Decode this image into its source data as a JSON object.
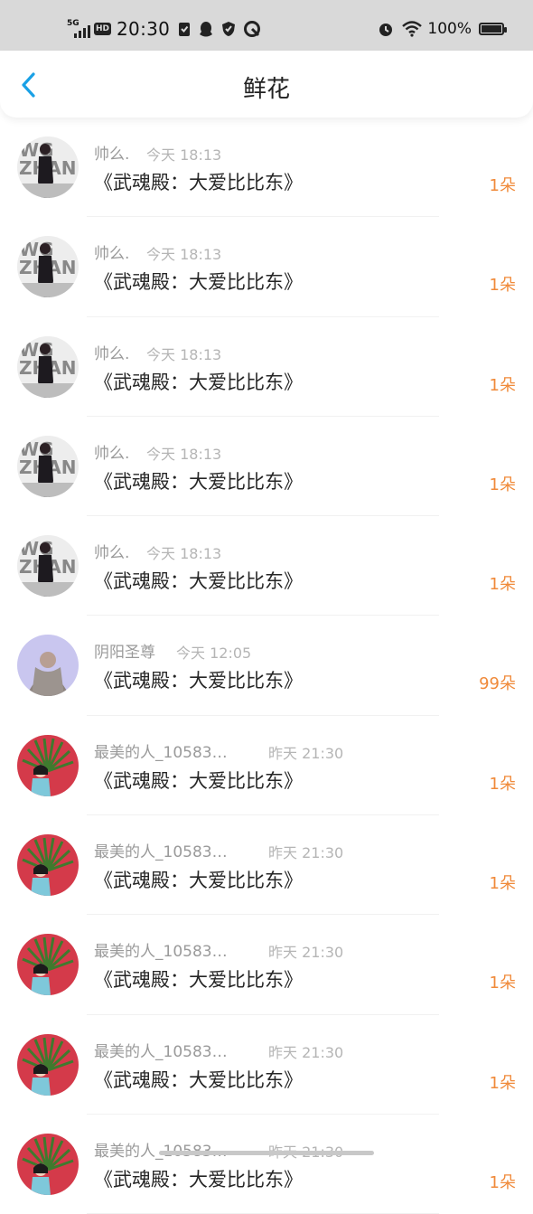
{
  "status_bar": {
    "network": "5G",
    "hd_label": "HD",
    "time": "20:30",
    "battery_text": "100%",
    "icons": [
      "signal-icon",
      "hd-icon",
      "clipboard-icon",
      "qq-icon",
      "shield-icon",
      "browser-icon",
      "alarm-icon",
      "wifi-icon",
      "battery-icon"
    ]
  },
  "header": {
    "title": "鲜花",
    "back_icon": "chevron-left-icon",
    "accent_color": "#1aa1e6"
  },
  "list": {
    "count_color": "#f08a3a",
    "items": [
      {
        "user": "帅么.",
        "time": "今天 18:13",
        "title": "《武魂殿：大爱比比东》",
        "count": "1朵",
        "avatar": "avatar-a"
      },
      {
        "user": "帅么.",
        "time": "今天 18:13",
        "title": "《武魂殿：大爱比比东》",
        "count": "1朵",
        "avatar": "avatar-a"
      },
      {
        "user": "帅么.",
        "time": "今天 18:13",
        "title": "《武魂殿：大爱比比东》",
        "count": "1朵",
        "avatar": "avatar-a"
      },
      {
        "user": "帅么.",
        "time": "今天 18:13",
        "title": "《武魂殿：大爱比比东》",
        "count": "1朵",
        "avatar": "avatar-a"
      },
      {
        "user": "帅么.",
        "time": "今天 18:13",
        "title": "《武魂殿：大爱比比东》",
        "count": "1朵",
        "avatar": "avatar-a"
      },
      {
        "user": "阴阳圣尊",
        "time": "今天 12:05",
        "title": "《武魂殿：大爱比比东》",
        "count": "99朵",
        "avatar": "avatar-b"
      },
      {
        "user": "最美的人_10583…",
        "time": "昨天 21:30",
        "title": "《武魂殿：大爱比比东》",
        "count": "1朵",
        "avatar": "avatar-c"
      },
      {
        "user": "最美的人_10583…",
        "time": "昨天 21:30",
        "title": "《武魂殿：大爱比比东》",
        "count": "1朵",
        "avatar": "avatar-c"
      },
      {
        "user": "最美的人_10583…",
        "time": "昨天 21:30",
        "title": "《武魂殿：大爱比比东》",
        "count": "1朵",
        "avatar": "avatar-c"
      },
      {
        "user": "最美的人_10583…",
        "time": "昨天 21:30",
        "title": "《武魂殿：大爱比比东》",
        "count": "1朵",
        "avatar": "avatar-c"
      },
      {
        "user": "最美的人_10583…",
        "time": "昨天 21:30",
        "title": "《武魂殿：大爱比比东》",
        "count": "1朵",
        "avatar": "avatar-c"
      }
    ]
  }
}
